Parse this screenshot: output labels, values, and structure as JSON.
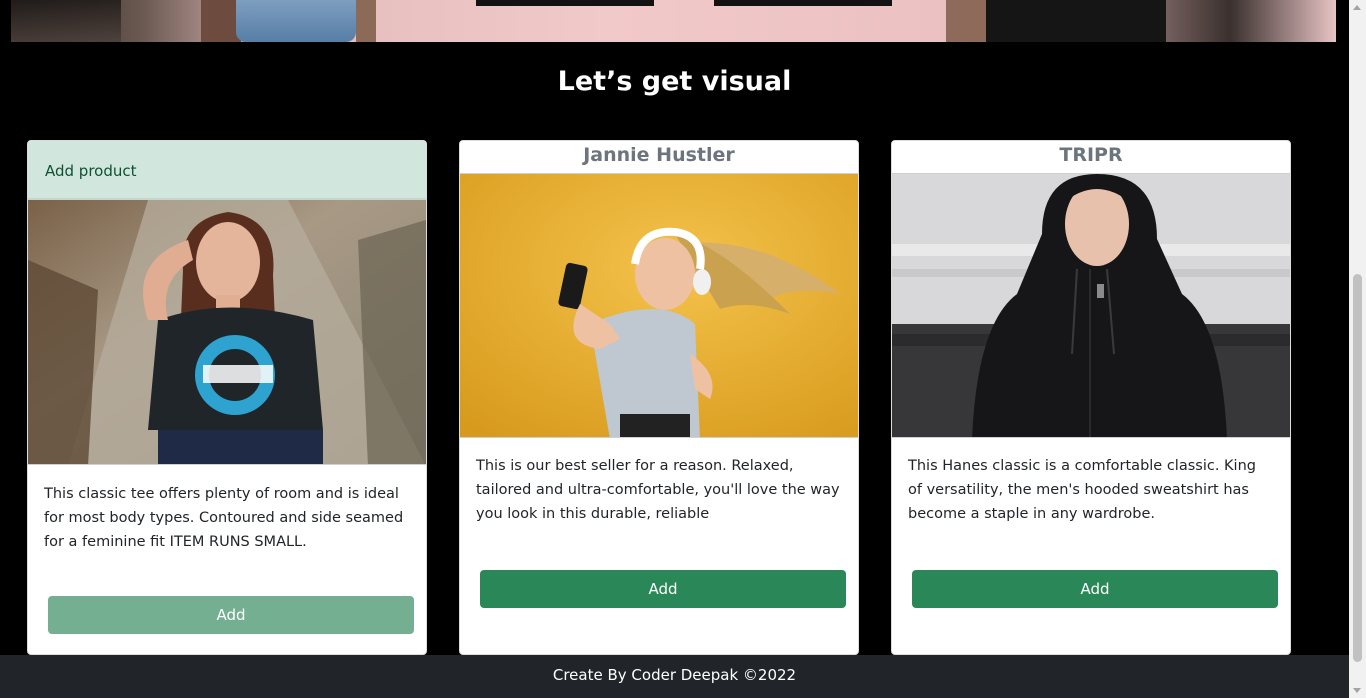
{
  "section": {
    "title": "Let’s get visual"
  },
  "cards": [
    {
      "header": "Add product",
      "image": "woman-in-oakley-tee-photo",
      "description": "This classic tee offers plenty of room and is ideal for most body types. Contoured and side seamed for a feminine fit ITEM RUNS SMALL.",
      "button": "Add"
    },
    {
      "title": "Jannie Hustler",
      "image": "woman-with-headphones-selfie-photo",
      "description": "This is our best seller for a reason. Relaxed, tailored and ultra-comfortable, you'll love the way you look in this durable, reliable",
      "button": "Add"
    },
    {
      "title": "TRIPR",
      "image": "man-in-black-hoodie-photo",
      "description": "This Hanes classic is a comfortable classic. King of versatility, the men's hooded sweatshirt has become a staple in any wardrobe.",
      "button": "Add"
    }
  ],
  "footer": {
    "text": "Create By Coder Deepak ©2022"
  },
  "colors": {
    "page_bg": "#000000",
    "header_success_bg": "#d1e7dd",
    "button_success": "#2a8858",
    "button_success_light": "#74af92",
    "footer_bg": "#212529"
  }
}
